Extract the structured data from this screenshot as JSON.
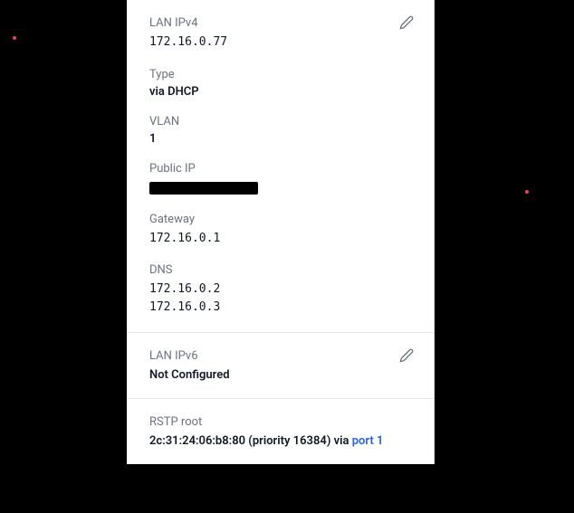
{
  "ipv4": {
    "header_label": "LAN IPv4",
    "address": "172.16.0.77",
    "type_label": "Type",
    "type_value": "via DHCP",
    "vlan_label": "VLAN",
    "vlan_value": "1",
    "public_ip_label": "Public IP",
    "gateway_label": "Gateway",
    "gateway_value": "172.16.0.1",
    "dns_label": "DNS",
    "dns1": "172.16.0.2",
    "dns2": "172.16.0.3"
  },
  "ipv6": {
    "header_label": "LAN IPv6",
    "status": "Not Configured"
  },
  "rstp": {
    "label": "RSTP root",
    "mac": "2c:31:24:06:b8:80",
    "priority_prefix": " (priority ",
    "priority_value": "16384",
    "priority_suffix": ") via ",
    "port_link": "port 1"
  }
}
